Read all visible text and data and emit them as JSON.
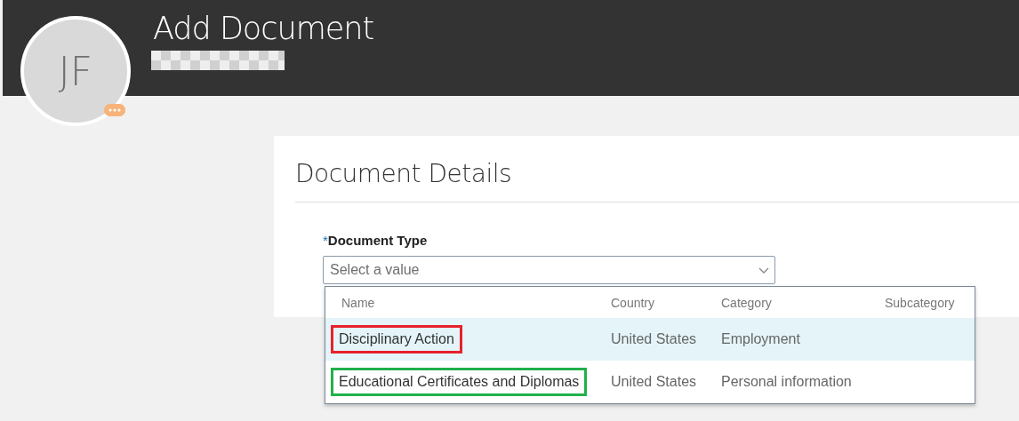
{
  "header": {
    "avatar_initials": "JF",
    "title": "Add Document"
  },
  "section": {
    "title": "Document Details"
  },
  "field": {
    "label": "Document Type",
    "required_mark": "*",
    "placeholder": "Select a value"
  },
  "dropdown": {
    "columns": [
      "Name",
      "Country",
      "Category",
      "Subcategory"
    ],
    "rows": [
      {
        "name": "Disciplinary Action",
        "country": "United States",
        "category": "Employment",
        "selected": true,
        "color": "#e8212b"
      },
      {
        "name": "Educational Certificates and Diplomas",
        "country": "United States",
        "category": "Personal information",
        "selected": false,
        "color": "#21b04b"
      }
    ]
  }
}
